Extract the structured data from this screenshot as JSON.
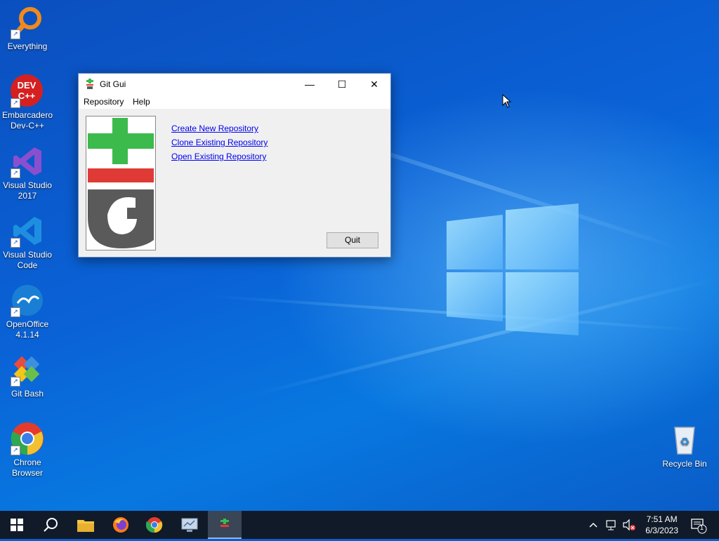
{
  "desktop": {
    "icons": [
      {
        "label": "Everything"
      },
      {
        "label": "Embarcadero Dev-C++"
      },
      {
        "label": "Visual Studio 2017"
      },
      {
        "label": "Visual Studio Code"
      },
      {
        "label": "OpenOffice 4.1.14"
      },
      {
        "label": "Git Bash"
      },
      {
        "label": "Chrone Browser"
      },
      {
        "label": "Recycle Bin"
      }
    ],
    "devcpp_icon_text": "DEV C++"
  },
  "gitgui": {
    "title": "Git Gui",
    "menu": {
      "repository": "Repository",
      "help": "Help"
    },
    "links": {
      "create": "Create New Repository",
      "clone": "Clone Existing Repository",
      "open": "Open Existing Repository"
    },
    "quit_label": "Quit",
    "controls": {
      "minimize": "—",
      "maximize": "☐",
      "close": "✕"
    }
  },
  "taskbar": {
    "clock_time": "7:51 AM",
    "clock_date": "6/3/2023",
    "notification_count": "1",
    "apps": [
      "start",
      "search",
      "file-explorer",
      "firefox",
      "chrome",
      "system-info",
      "git-gui"
    ]
  },
  "colors": {
    "link": "#0000ee",
    "git_green": "#3cba4b",
    "git_red": "#e03a36",
    "git_gray": "#5a5a5a"
  }
}
